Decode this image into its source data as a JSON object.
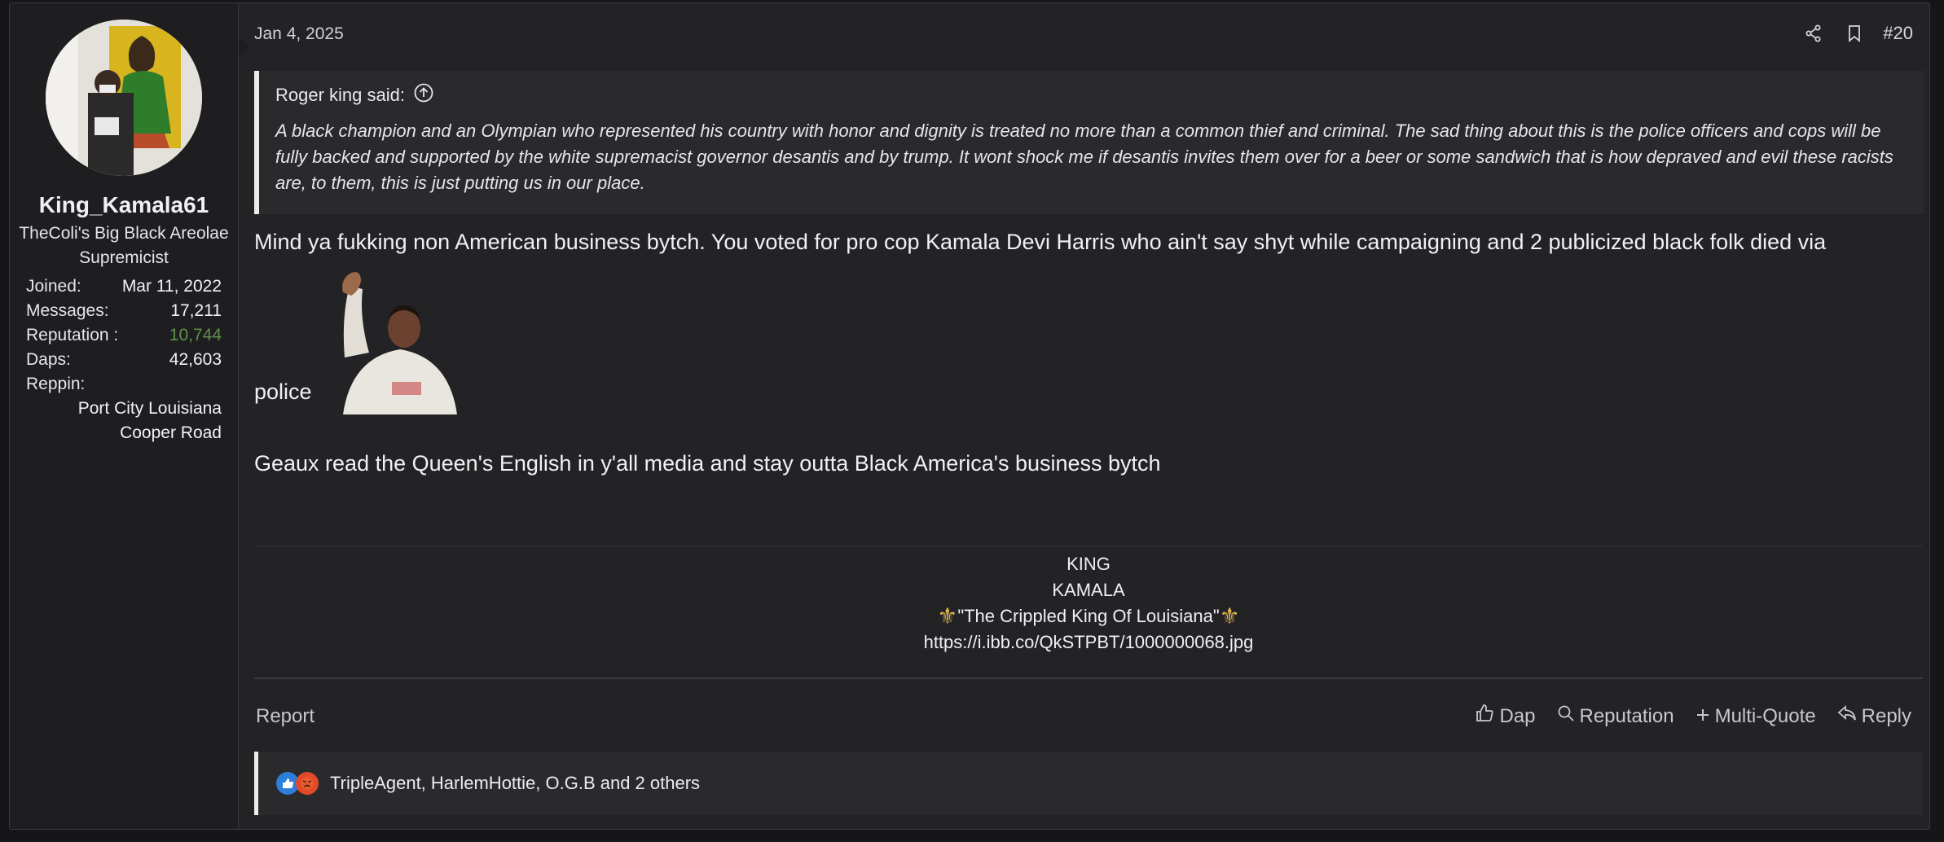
{
  "user": {
    "username": "King_Kamala61",
    "title": "TheColi's Big Black Areolae Supremicist",
    "stats": [
      {
        "label": "Joined:",
        "value": "Mar 11, 2022"
      },
      {
        "label": "Messages:",
        "value": "17,211"
      },
      {
        "label": "Reputation :",
        "value": "10,744"
      },
      {
        "label": "Daps:",
        "value": "42,603"
      }
    ],
    "reppin_label": "Reppin:",
    "reppin_lines": [
      "Port City Louisiana",
      "Cooper Road"
    ]
  },
  "post": {
    "date": "Jan 4, 2025",
    "number": "#20",
    "quote": {
      "author": "Roger king said:",
      "text": "A black champion and an Olympian who represented his country with honor and dignity is treated no more than a common thief and criminal. The sad thing about this is the police officers and cops will be fully backed and supported by the white supremacist governor desantis and by trump. It wont shock me if desantis invites them over for a beer or some sandwich that is how depraved and evil these racists are, to them, this is just putting us in our place."
    },
    "message_line1": "Mind ya fukking non American business bytch. You voted for pro cop Kamala Devi Harris who ain't say shyt while campaigning and 2 publicized black folk died via",
    "message_line1_end": "police",
    "message_line2": "Geaux read the Queen's English in y'all media and stay outta Black America's business bytch"
  },
  "signature": {
    "line1": "KING",
    "line2": "KAMALA",
    "line3": "\"The Crippled King Of Louisiana\"",
    "line4": "https://i.ibb.co/QkSTPBT/1000000068.jpg"
  },
  "footer": {
    "report": "Report",
    "dap": "Dap",
    "reputation": "Reputation",
    "multi_quote": "Multi-Quote",
    "reply": "Reply"
  },
  "reactions": {
    "text": "TripleAgent, HarlemHottie, O.G.B and 2 others"
  }
}
